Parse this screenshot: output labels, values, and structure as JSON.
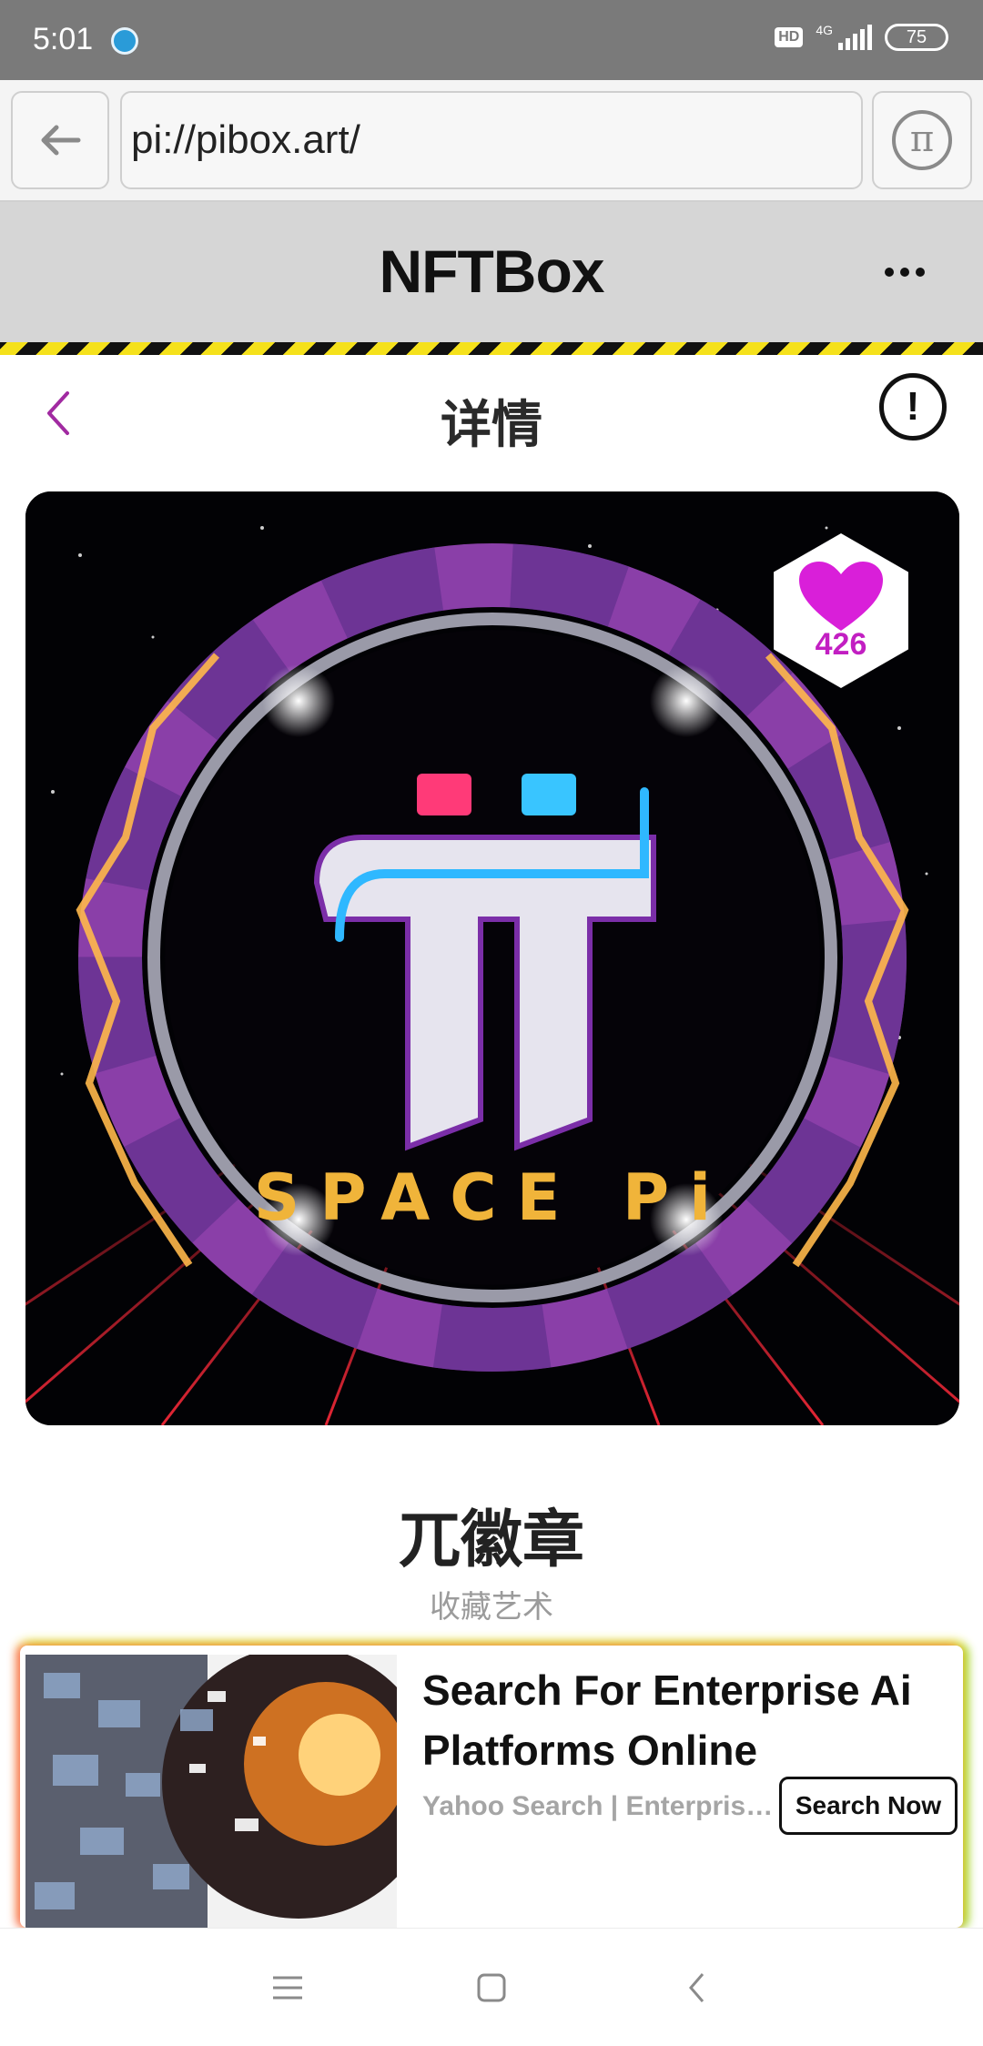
{
  "status_bar": {
    "time": "5:01",
    "hd": "HD",
    "network": "4G",
    "battery": "75",
    "signal_level": 4
  },
  "browser": {
    "url": "pi://pibox.art/",
    "back_icon": "arrow-left-icon",
    "pi_icon": "pi-logo-icon"
  },
  "app": {
    "title": "NFTBox",
    "more_icon": "more-dots-icon"
  },
  "detail": {
    "title": "详情",
    "back_icon": "chevron-left-icon",
    "info_symbol": "!"
  },
  "nft": {
    "name": "兀徽章",
    "category": "收藏艺术",
    "likes": "426",
    "image_text": "SPACE Pi",
    "accent_color": "#c21fc2"
  },
  "ad": {
    "headline": "Search For Enterprise Ai Platforms Online",
    "source": "Yahoo Search | Enterprise Ai Platforms",
    "cta": "Search Now"
  },
  "nav": {
    "menu_icon": "menu-icon",
    "home_icon": "home-square-icon",
    "back_icon": "back-chevron-icon"
  }
}
